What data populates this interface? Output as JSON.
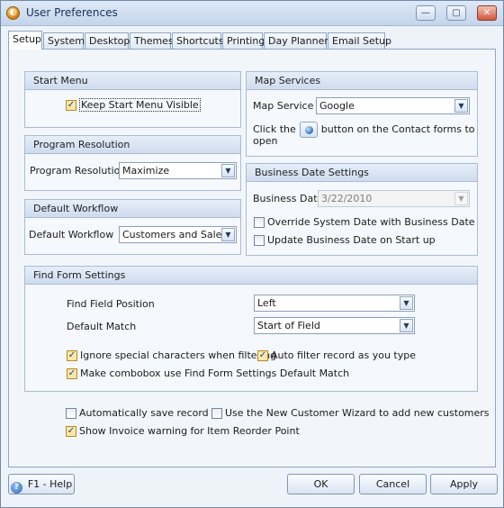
{
  "window": {
    "title": "User Preferences",
    "minimize": "—",
    "maximize": "▢",
    "close": "✕"
  },
  "tabs": [
    "Setup",
    "System",
    "Desktop",
    "Themes",
    "Shortcuts",
    "Printing",
    "Day Planner",
    "Email Setup"
  ],
  "start_menu": {
    "header": "Start Menu",
    "keep_visible": {
      "label": "Keep Start Menu Visible",
      "checked": true
    }
  },
  "program_resolution": {
    "header": "Program Resolution",
    "label": "Program Resolution",
    "value": "Maximize"
  },
  "default_workflow": {
    "header": "Default Workflow",
    "label": "Default Workflow",
    "value": "Customers and Sales"
  },
  "map_services": {
    "header": "Map Services",
    "label": "Map Service",
    "value": "Google",
    "click_the": "Click the",
    "button_on": "button on the Contact forms to",
    "open": "open"
  },
  "business_date": {
    "header": "Business Date Settings",
    "label": "Business Date",
    "value": "3/22/2010",
    "override": {
      "label": "Override System Date with Business Date",
      "checked": false
    },
    "update_on_start": {
      "label": "Update Business Date on Start up",
      "checked": false
    }
  },
  "find_form": {
    "header": "Find Form Settings",
    "field_position_label": "Find Field Position",
    "field_position_value": "Left",
    "default_match_label": "Default Match",
    "default_match_value": "Start of Field",
    "ignore_special": {
      "label": "Ignore special characters when filtering",
      "checked": true
    },
    "auto_filter": {
      "label": "Auto filter record as you type",
      "checked": true
    },
    "combobox_default": {
      "label": "Make combobox use Find Form Settings Default Match",
      "checked": true
    }
  },
  "general": {
    "auto_save": {
      "label": "Automatically save record",
      "checked": false
    },
    "new_customer_wizard": {
      "label": "Use the New Customer Wizard to add new customers",
      "checked": false
    },
    "invoice_warning": {
      "label": "Show Invoice warning for Item Reorder Point",
      "checked": true
    }
  },
  "footer": {
    "help": "F1 - Help",
    "help_icon_glyph": "?",
    "ok": "OK",
    "cancel": "Cancel",
    "apply": "Apply"
  },
  "glyphs": {
    "check": "✓",
    "dropdown": "▼"
  },
  "colors": {
    "title_text": "#15325b",
    "group_header": "#cfdcee",
    "checked_box": "#fbe7a8",
    "window_border": "#6f89ab"
  }
}
